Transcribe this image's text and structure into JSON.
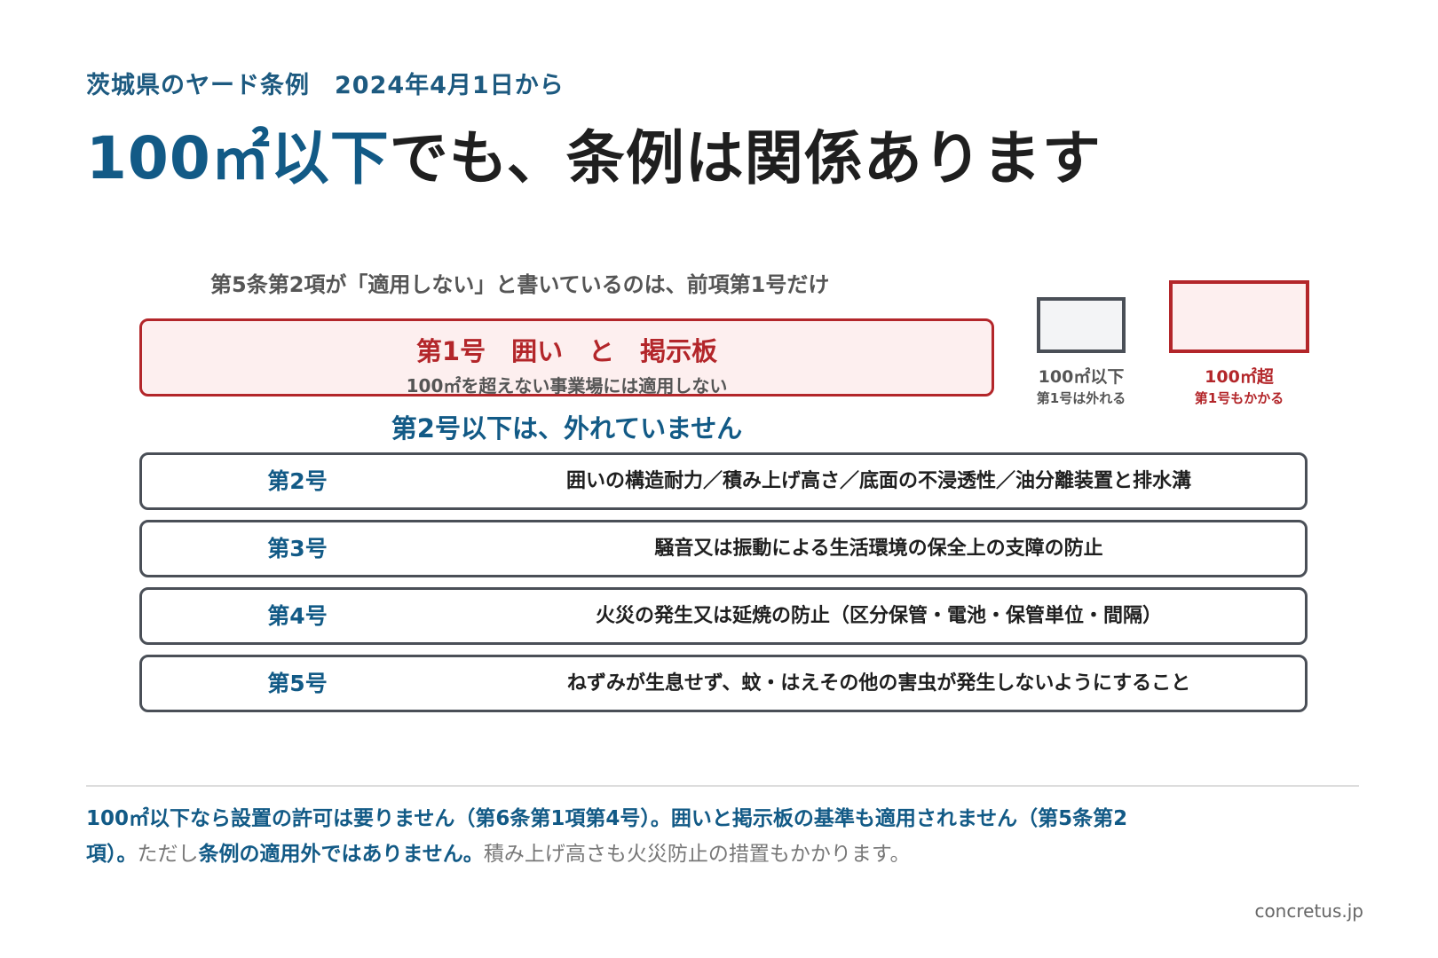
{
  "header": {
    "eyebrow": "茨城県のヤード条例　2024年4月1日から",
    "headline_highlight": "100㎡以下",
    "headline_rest": "でも、条例は関係あります"
  },
  "subhead": "第5条第2項が「適用しない」と書いているのは、前項第1号だけ",
  "item1": {
    "title": "第1号　囲い　と　掲示板",
    "note": "100㎡を超えない事業場には適用しない"
  },
  "legend": {
    "small": {
      "label": "100㎡以下",
      "sub": "第1号は外れる"
    },
    "large": {
      "label": "100㎡超",
      "sub": "第1号もかかる"
    }
  },
  "mid_label": "第2号以下は、外れていません",
  "items": [
    {
      "num": "第2号",
      "desc": "囲いの構造耐力／積み上げ高さ／底面の不浸透性／油分離装置と排水溝"
    },
    {
      "num": "第3号",
      "desc": "騒音又は振動による生活環境の保全上の支障の防止"
    },
    {
      "num": "第4号",
      "desc": "火災の発生又は延焼の防止（区分保管・電池・保管単位・間隔）"
    },
    {
      "num": "第5号",
      "desc": "ねずみが生息せず、蚊・はえその他の害虫が発生しないようにすること"
    }
  ],
  "footnote": {
    "part1": "100㎡以下なら設置の許可は要りません（第6条第1項第4号）。囲いと掲示板の基準も適用されません（第5条第2項）。",
    "part2": "ただし",
    "part3": "条例の適用外ではありません。",
    "part4": "積み上げ高さも火災防止の措置もかかります。"
  },
  "credit": "concretus.jp",
  "colors": {
    "accent_blue": "#125a86",
    "accent_red": "#b3262a",
    "border_gray": "#4a4f57"
  }
}
